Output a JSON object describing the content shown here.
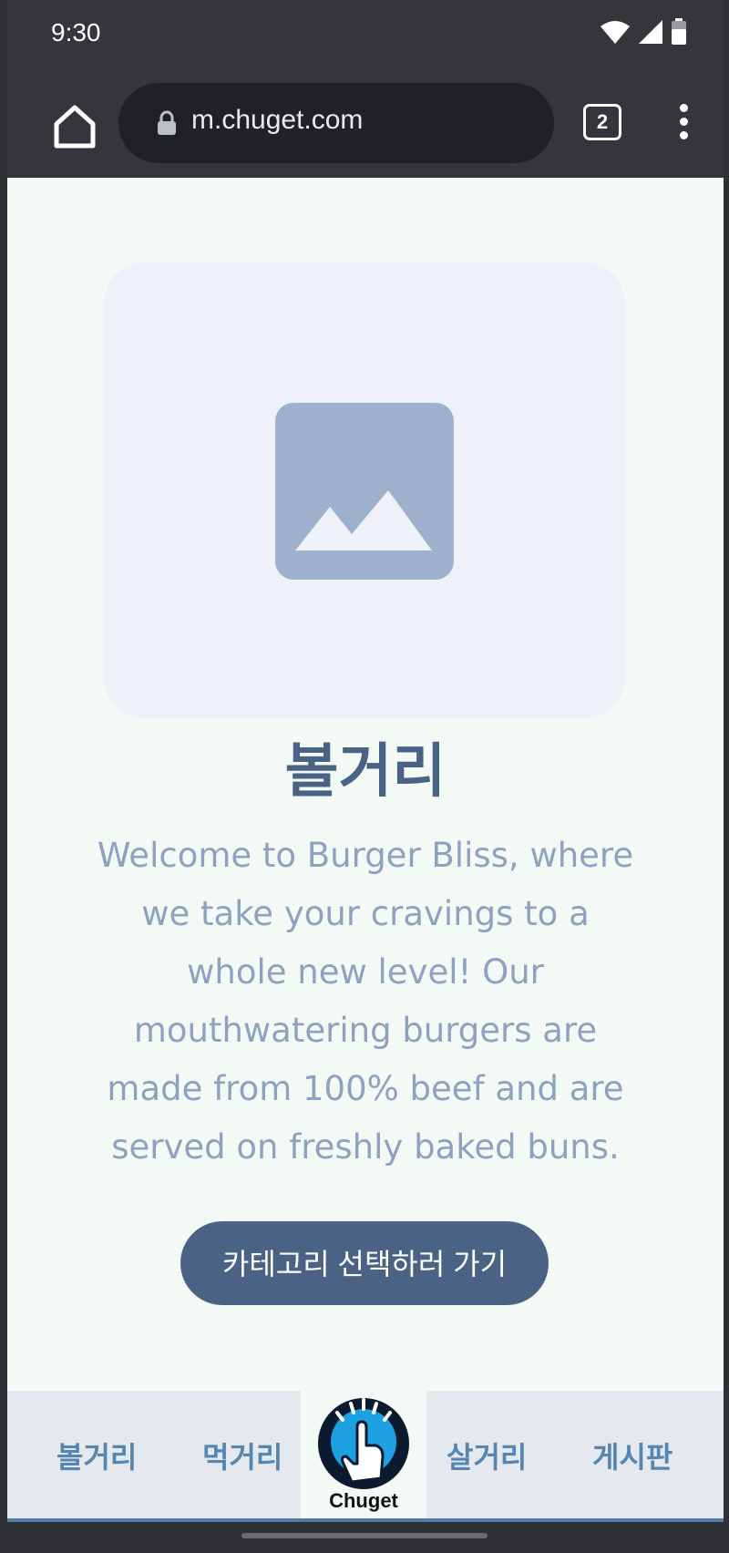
{
  "status": {
    "time": "9:30"
  },
  "browser": {
    "url": "m.chuget.com",
    "tab_count": "2"
  },
  "hero": {
    "title": "볼거리",
    "description": "Welcome to Burger Bliss, where we take your cravings to a whole new level! Our mouthwatering burgers are made from 100% beef and are served on freshly baked buns.",
    "cta_label": "카테고리 선택하러 가기"
  },
  "nav": {
    "items": [
      "볼거리",
      "먹거리",
      "살거리",
      "게시판"
    ],
    "logo_text": "Chuget"
  },
  "colors": {
    "accent": "#4a6283",
    "nav_text": "#5485b3",
    "background": "#f3faf6",
    "placeholder": "#9db0cc"
  }
}
